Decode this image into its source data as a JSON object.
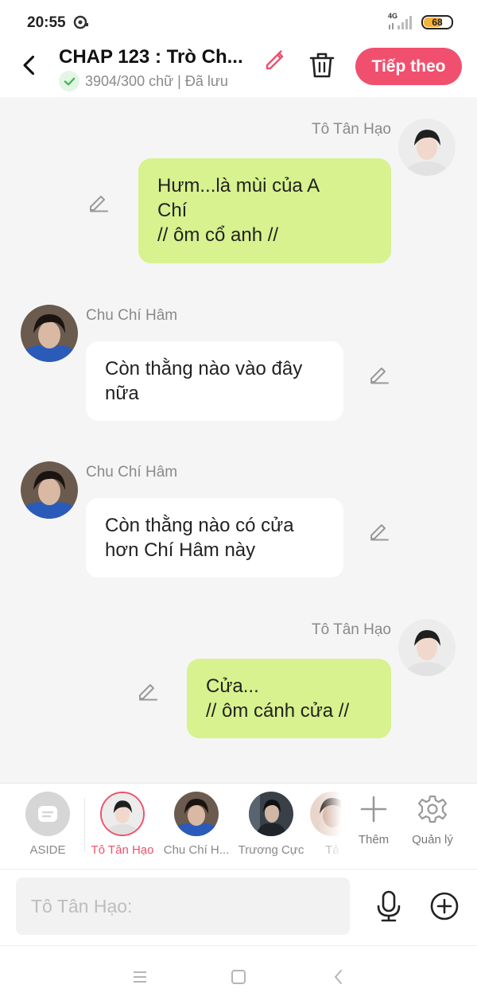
{
  "status_bar": {
    "time": "20:55",
    "network": "4G",
    "battery": "68",
    "battery_percent": 68
  },
  "header": {
    "title": "CHAP 123 : Trò Ch...",
    "word_count": "3904/300 chữ | Đã lưu",
    "next_label": "Tiếp theo",
    "accent_color": "#f0506e"
  },
  "messages": [
    {
      "sender": "Tô Tân Hạo",
      "side": "right",
      "lines": [
        "Hưm...là mùi của A",
        "Chí",
        "// ôm cổ anh //"
      ]
    },
    {
      "sender": "Chu Chí Hâm",
      "side": "left",
      "lines": [
        "Còn thằng nào vào đây",
        "nữa"
      ]
    },
    {
      "sender": "Chu Chí Hâm",
      "side": "left",
      "lines": [
        "Còn thằng nào có cửa",
        "hơn Chí Hâm này"
      ]
    },
    {
      "sender": "Tô Tân Hạo",
      "side": "right",
      "lines": [
        "Cửa...",
        "// ôm cánh cửa //"
      ]
    }
  ],
  "characters": {
    "aside_label": "ASIDE",
    "items": [
      {
        "name": "Tô Tân Hạo",
        "selected": true
      },
      {
        "name": "Chu Chí H...",
        "selected": false
      },
      {
        "name": "Trương Cực",
        "selected": false
      },
      {
        "name": "Tả",
        "selected": false
      }
    ],
    "add_label": "Thêm",
    "manage_label": "Quản lý"
  },
  "input": {
    "placeholder": "Tô Tân Hạo:"
  },
  "colors": {
    "right_bubble": "#d7f28e",
    "left_bubble": "#ffffff",
    "background": "#f5f5f5"
  }
}
